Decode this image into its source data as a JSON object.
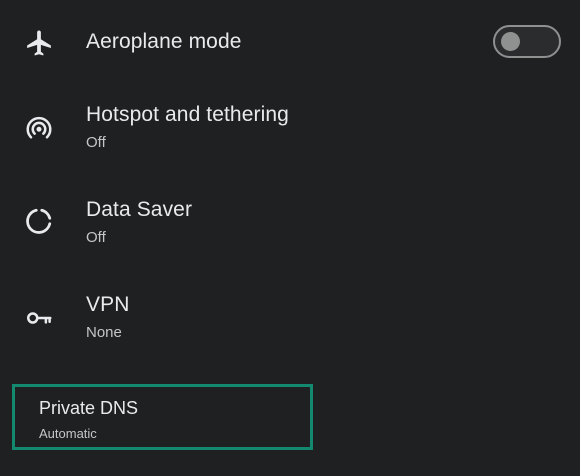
{
  "settings": {
    "aeroplane": {
      "title": "Aeroplane mode",
      "icon": "airplane-icon",
      "toggle_on": false
    },
    "hotspot": {
      "title": "Hotspot and tethering",
      "subtitle": "Off",
      "icon": "hotspot-icon"
    },
    "data_saver": {
      "title": "Data Saver",
      "subtitle": "Off",
      "icon": "data-saver-icon"
    },
    "vpn": {
      "title": "VPN",
      "subtitle": "None",
      "icon": "key-icon"
    },
    "private_dns": {
      "title": "Private DNS",
      "subtitle": "Automatic",
      "highlighted": true
    }
  },
  "colors": {
    "background": "#1f2022",
    "text_primary": "#e8eaed",
    "text_secondary": "#c4c7c5",
    "highlight_border": "#138a6f",
    "toggle_off": "#8e918f"
  }
}
